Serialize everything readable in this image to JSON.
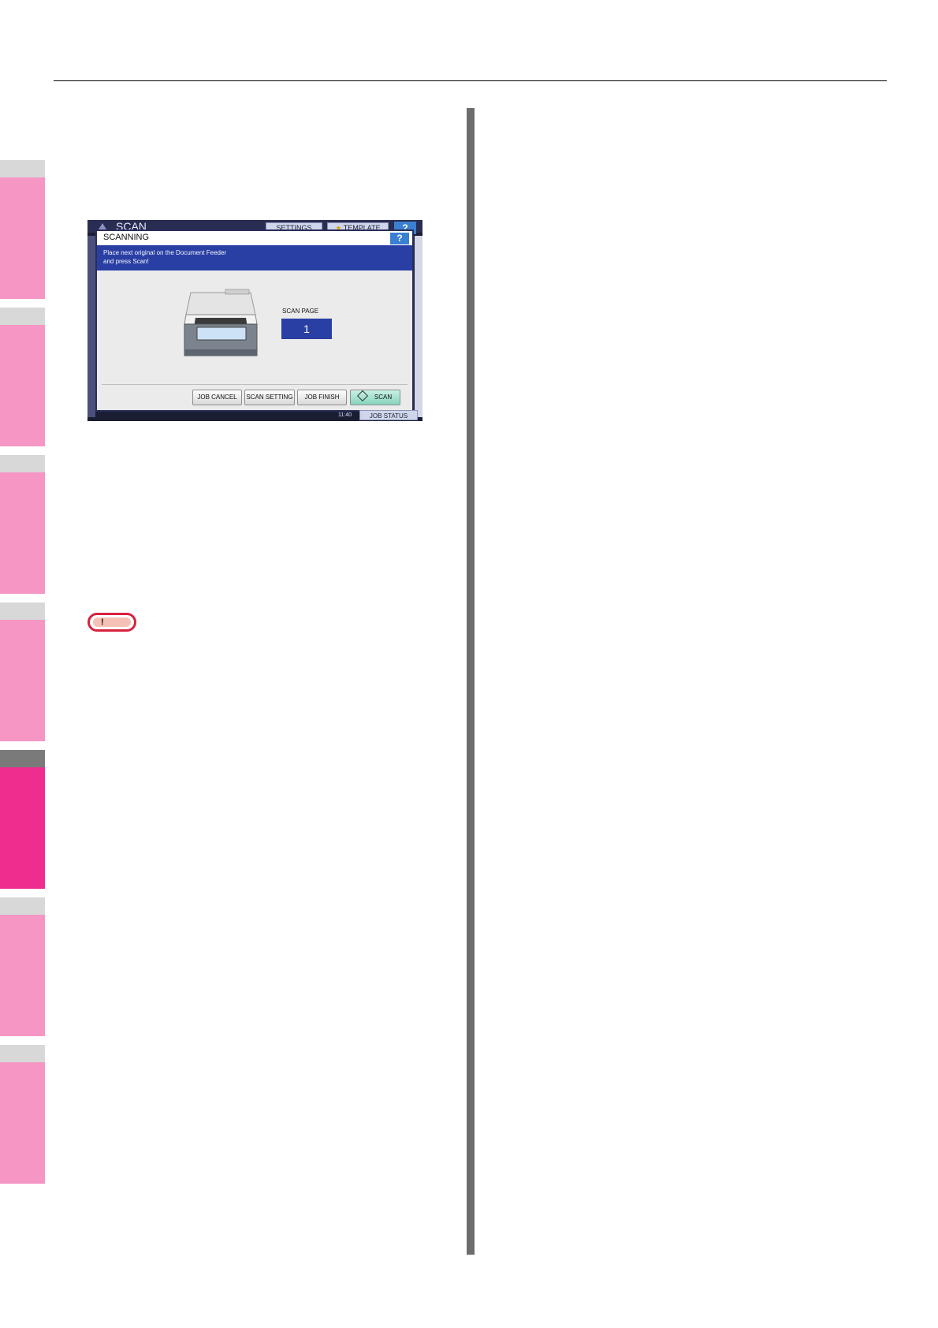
{
  "panel": {
    "title": "SCAN",
    "settings_label": "SETTINGS",
    "template_label": "TEMPLATE",
    "help_label": "?",
    "dialog": {
      "title": "SCANNING",
      "help_label": "?",
      "message_line1": "Place next original on the Document Feeder",
      "message_line2": "and press Scan!",
      "scan_page_label": "SCAN PAGE",
      "scan_page_value": "1",
      "buttons": {
        "job_cancel": "JOB CANCEL",
        "scan_setting": "SCAN SETTING",
        "job_finish": "JOB FINISH",
        "scan": "SCAN"
      }
    },
    "time": "11:40",
    "job_status_label": "JOB STATUS"
  },
  "caution": {
    "mark": "!"
  },
  "colors": {
    "tab_pink": "#f596c4",
    "tab_active": "#ee2d8f",
    "caution_red": "#d8203f",
    "dialog_blue": "#2a3fa3"
  }
}
